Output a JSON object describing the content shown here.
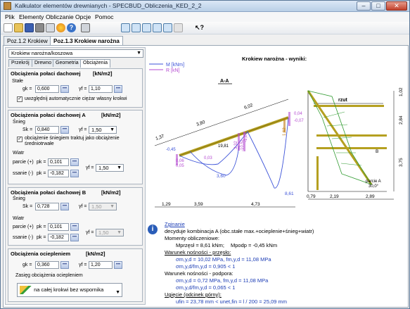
{
  "window": {
    "title": "Kalkulator elementów drewnianych - SPECBUD_Obliczenia_KED_2_2",
    "min": "–",
    "max": "□",
    "close": "✕"
  },
  "menu": [
    "Plik",
    "Elementy",
    "Obliczanie",
    "Opcje",
    "Pomoc"
  ],
  "toolbar_icons": [
    "new-icon",
    "open-icon",
    "save-icon",
    "print-icon",
    "preview-icon",
    "color-icon",
    "help-icon",
    "calculator-icon",
    "element-icon-1",
    "element-icon-2",
    "element-icon-3",
    "element-icon-4",
    "element-icon-5",
    "element-icon-6",
    "help-pointer-icon"
  ],
  "tabs": [
    "Poz.1.2 Krokiew",
    "Poz.1.3 Krokiew narożna"
  ],
  "element_type": "Krokiew narożna/koszowa",
  "subtabs": [
    "Przekrój",
    "Drewno",
    "Geometria",
    "Obciążenia"
  ],
  "roof_load": {
    "title": "Obciążenia połaci dachowej",
    "unit": "[kN/m2]",
    "stale": "Stałe",
    "gk_label": "gk =",
    "gk": "0,600",
    "gf_label": "γf =",
    "gf": "1,10",
    "auto_weight": "uwzględnij automatycznie ciężar własny krokwi"
  },
  "roof_A": {
    "title": "Obciążenia połaci dachowej A",
    "unit": "[kN/m2]",
    "snieg": "Śnieg",
    "sk_label": "Sk =",
    "sk": "0,840",
    "gf": "1,50",
    "sustained": "obciążenie śniegiem traktuj jako obciążenie średniotrwałe",
    "wiatr": "Wiatr",
    "parcie": "parcie (+)",
    "ssanie": "ssanie (-)",
    "pk_label": "pk =",
    "pk_plus": "0,101",
    "pk_minus": "-0,182",
    "gf_wind": "1,50"
  },
  "roof_B": {
    "title": "Obciążenia połaci dachowej B",
    "unit": "[kN/m2]",
    "snieg": "Śnieg",
    "sk": "0,728",
    "gf": "1,50",
    "wiatr": "Wiatr",
    "pk_plus": "0,101",
    "pk_minus": "-0,182",
    "gf_wind": "1,50"
  },
  "insulation": {
    "title": "Obciążenia ociepleniem",
    "unit": "[kN/m2]",
    "gk": "0,360",
    "gf": "1,20",
    "range_label": "Zasięg obciążenia ociepleniem",
    "range_value": "na całej krokwi bez wspornika"
  },
  "results": {
    "title": "Krokiew narożna - wyniki:",
    "legend_M": "M [kNm]",
    "legend_R": "R [kN]",
    "section_AA": "A-A",
    "section_rzut": "rzut",
    "dims_bottom": [
      "1,29",
      "3,59",
      "4,73"
    ],
    "dims_top": [
      "1,37",
      "3,80",
      "6,02"
    ],
    "dims_right_bottom": [
      "0,79",
      "2,19",
      "2,89"
    ],
    "dims_right_side": [
      "1,02",
      "2,84",
      "3,75"
    ],
    "beam_values": [
      "0,04",
      "-0,07",
      "-0,45",
      "0,06",
      "0,05",
      "19,81",
      "1,62",
      "3,32",
      "0,03",
      "-10,52",
      "-1,17",
      "3,60",
      "8,61"
    ],
    "plan_labels": [
      "B",
      "parcie A",
      "30,0°"
    ]
  },
  "summary": {
    "heading": "Zginanie",
    "decide": "decyduje kombinacja A (obc.stałe max.+ocieplenie+śnieg+wiatr)",
    "moments": "Momenty obliczeniowe:",
    "Mprzesl": "Mprzęsł = 8,61 kNm;",
    "Mpodp": "Mpodp = -0,45 kNm",
    "sgn_span": "Warunek nośności - przęsło:",
    "sigma_span": "σm,y,d = 10,02 MPa,  fm,y,d = 11,08 MPa",
    "ratio_span": "σm,y,d/fm,y,d = 0,905  <  1",
    "sgn_supp": "Warunek nośności - podpora:",
    "sigma_supp": "σm,y,d = 0,72 MPa,  fm,y,d = 11,08 MPa",
    "ratio_supp": "σm,y,d/fm,y,d = 0,065  <  1",
    "deflection": "Ugięcie (odcinek górny):",
    "ufin": "ufin = 23,78 mm  <  unet,fin = l / 200 = 25,09 mm"
  },
  "colors": {
    "moment": "#3b52d8",
    "reaction": "#b44ad0",
    "beam": "#b5a020",
    "axial": "#c07a10",
    "hatch": "#2e9a2e"
  }
}
